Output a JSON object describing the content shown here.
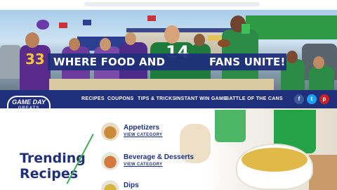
{
  "hero": {
    "jersey_left_number": "33",
    "jersey_center_number": "14",
    "headline_left": "WHERE FOOD AND",
    "headline_right": "FANS UNITE!"
  },
  "logo": {
    "line1": "GAME DAY",
    "line2": "GREATS"
  },
  "nav": {
    "items": [
      "RECIPES",
      "COUPONS",
      "TIPS & TRICKS",
      "INSTANT WIN GAME",
      "BATTLE OF THE CANS"
    ],
    "social": [
      "f",
      "t",
      "p"
    ]
  },
  "main": {
    "trending_line1": "Trending",
    "trending_line2": "Recipes",
    "categories": [
      {
        "title": "Appetizers",
        "link": "VIEW CATEGORY"
      },
      {
        "title": "Beverage & Desserts",
        "link": "VIEW CATEGORY"
      },
      {
        "title": "Dips",
        "link": ""
      }
    ]
  },
  "colors": {
    "navy": "#1f2f7a",
    "green": "#2eaa4d",
    "purple": "#5a2a8c"
  }
}
